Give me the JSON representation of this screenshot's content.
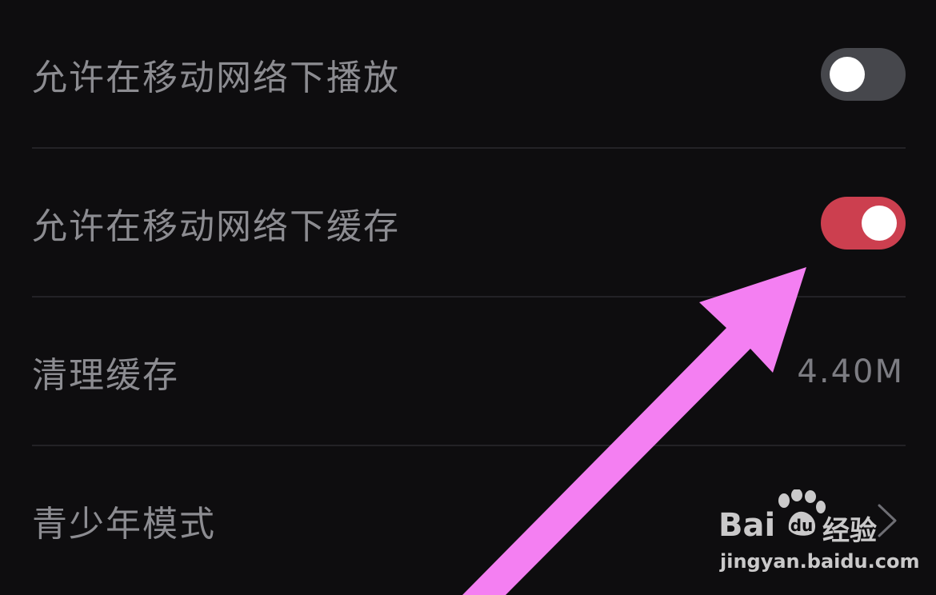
{
  "settings": {
    "items": [
      {
        "label": "允许在移动网络下播放",
        "control": "toggle",
        "state": "off"
      },
      {
        "label": "允许在移动网络下缓存",
        "control": "toggle",
        "state": "on"
      },
      {
        "label": "清理缓存",
        "control": "value",
        "value": "4.40M"
      },
      {
        "label": "青少年模式",
        "control": "chevron"
      }
    ]
  },
  "colors": {
    "background": "#0e0d0f",
    "toggle_off": "#46474c",
    "toggle_on": "#cc3f4f",
    "annotation_arrow": "#f47ff2",
    "divider": "#232226"
  },
  "watermark": {
    "brand": "Bai",
    "brand_cn": "经验",
    "site": "jingyan.baidu.com"
  }
}
